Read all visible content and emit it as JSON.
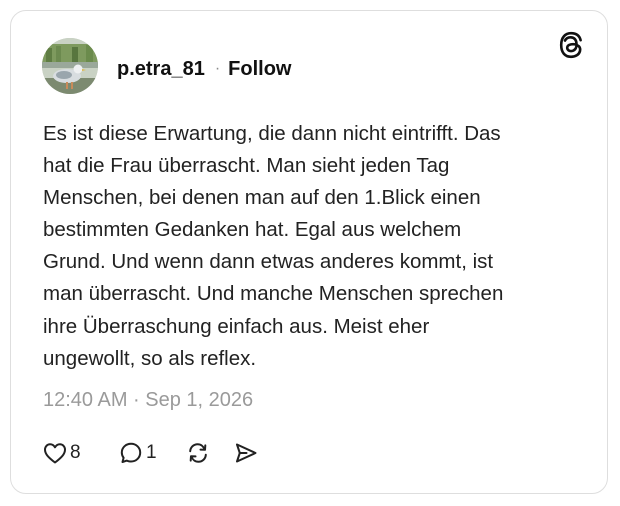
{
  "post": {
    "username": "p.etra_81",
    "separator": "·",
    "follow_label": "Follow",
    "body": "Es ist diese Erwartung, die dann nicht eintrifft. Das\nhat die Frau überrascht. Man sieht jeden Tag\nMenschen, bei denen man auf den 1.Blick einen\nbestimmten Gedanken hat. Egal aus welchem\nGrund. Und wenn dann etwas anderes kommt, ist\nman überrascht. Und manche Menschen sprechen\nihre Überraschung einfach aus. Meist eher\nungewollt, so als reflex.",
    "timestamp": "12:40 AM · Sep 1, 2026"
  },
  "actions": {
    "likes": "8",
    "replies": "1"
  },
  "icons": {
    "logo": "threads-logo-icon",
    "like": "heart-icon",
    "reply": "speech-bubble-icon",
    "repost": "repost-icon",
    "share": "send-icon"
  },
  "colors": {
    "text": "#111111",
    "muted": "#9a9a9a",
    "border": "#dedede"
  }
}
